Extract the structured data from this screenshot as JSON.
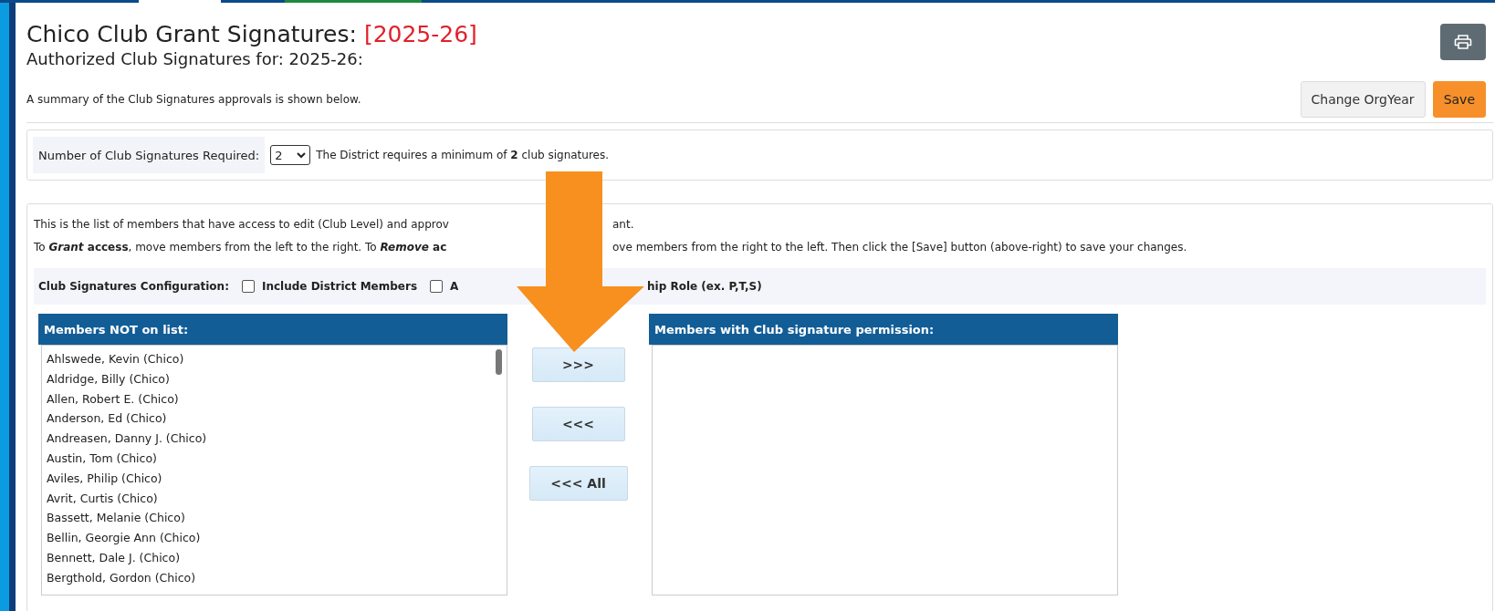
{
  "page": {
    "title": "Chico Club Grant Signatures:",
    "year": "[2025-26]",
    "subtitle": "Authorized Club Signatures for: 2025-26:",
    "summary": "A summary of the Club Signatures approvals is shown below."
  },
  "toolbar": {
    "buttons": [
      {
        "label": "Change OrgYear",
        "kind": "default"
      },
      {
        "label": "Save",
        "kind": "primary"
      }
    ]
  },
  "requirement": {
    "label": "Number of Club Signatures Required:",
    "value": "2",
    "note": "The District requires a minimum of **2** club signatures."
  },
  "instructions": [
    {
      "before": "This is the list of members that have access to edit (Club Level) and approv",
      "after": "ant."
    },
    {
      "before": "To ***Grant* access**, move members from the left to the right. To ***Remove* ac**",
      "after": "ove members from the right to the left. Then click the [Save] button (above-right) to save your changes."
    }
  ],
  "configuration": {
    "label": "Club Signatures Configuration:",
    "options": [
      {
        "label": "Include District Members",
        "checked": false
      },
      {
        "label": "A",
        "checked": false
      }
    ],
    "trailing": "hip Role (ex. P,T,S)"
  },
  "available": {
    "header": "Members NOT on list:",
    "items": [
      "Ahlswede, Kevin (Chico)",
      "Aldridge, Billy (Chico)",
      "Allen, Robert E. (Chico)",
      "Anderson, Ed (Chico)",
      "Andreasen, Danny J. (Chico)",
      "Austin, Tom (Chico)",
      "Aviles, Philip (Chico)",
      "Avrit, Curtis (Chico)",
      "Bassett, Melanie (Chico)",
      "Bellin, Georgie Ann (Chico)",
      "Bennett, Dale J. (Chico)",
      "Bergthold, Gordon (Chico)"
    ]
  },
  "transfer_buttons": [
    ">>>",
    "<<<",
    "<<< All"
  ],
  "granted": {
    "header": "Members with Club signature permission:"
  }
}
